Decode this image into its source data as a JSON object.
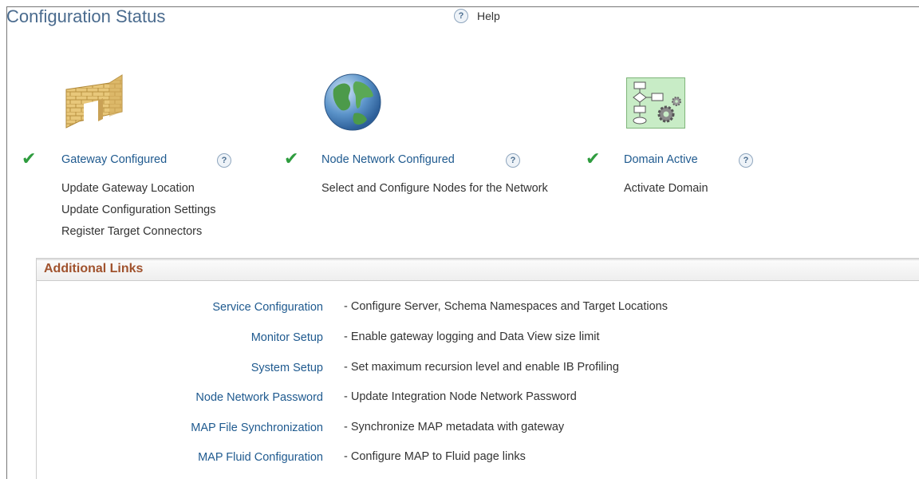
{
  "page": {
    "title": "Configuration Status",
    "help_label": "Help"
  },
  "steps": [
    {
      "status": "complete",
      "link": "Gateway Configured",
      "icon": "brick-wall-icon",
      "sub_links": [
        "Update Gateway Location",
        "Update Configuration Settings",
        "Register Target Connectors"
      ]
    },
    {
      "status": "complete",
      "link": "Node Network Configured",
      "icon": "globe-icon",
      "sub_links": [
        "Select and Configure Nodes for the Network"
      ]
    },
    {
      "status": "complete",
      "link": "Domain Active",
      "icon": "flowchart-gear-icon",
      "sub_links": [
        "Activate Domain"
      ]
    }
  ],
  "help_glyph": "?",
  "check_glyph": "✔",
  "additional_links": {
    "title": "Additional Links",
    "rows": [
      {
        "link": "Service Configuration",
        "desc": "- Configure Server, Schema Namespaces and Target Locations"
      },
      {
        "link": "Monitor Setup",
        "desc": "- Enable gateway logging and Data View size limit"
      },
      {
        "link": "System Setup",
        "desc": "- Set maximum recursion level and enable IB Profiling"
      },
      {
        "link": "Node Network Password",
        "desc": "- Update Integration Node Network Password"
      },
      {
        "link": "MAP File Synchronization",
        "desc": "- Synchronize MAP metadata with gateway"
      },
      {
        "link": "MAP Fluid Configuration",
        "desc": "- Configure MAP to Fluid page links"
      }
    ]
  },
  "colors": {
    "link": "#1f5a8f",
    "check": "#2e9c3e",
    "title": "#4a6b8e",
    "section_title": "#a0522d"
  }
}
